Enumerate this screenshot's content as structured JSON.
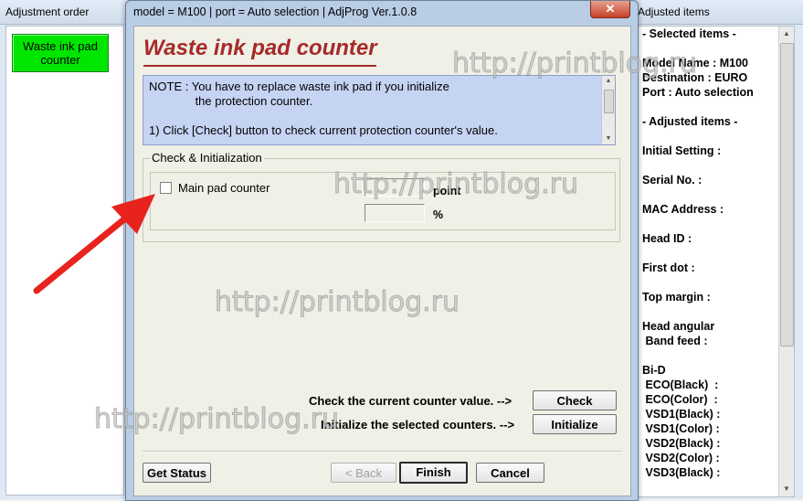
{
  "left_window": {
    "title": "Adjustment order",
    "button": "Waste ink pad\ncounter",
    "button_color": "#00e600"
  },
  "dialog": {
    "title": "model = M100 | port = Auto selection | AdjProg Ver.1.0.8",
    "close_glyph": "✕",
    "heading": "Waste ink pad counter",
    "note": "NOTE : You have to replace waste ink pad if you initialize\n              the protection counter.\n\n1) Click [Check] button to check current protection counter's value.",
    "group_label": "Check & Initialization",
    "checkbox_label": "Main pad counter",
    "unit_point": "point",
    "unit_percent": "%",
    "check_hint": "Check the current counter value.  -->",
    "check_btn": "Check",
    "init_hint": "Initialize the selected counters.  -->",
    "init_btn": "Initialize",
    "get_status_btn": "Get Status",
    "back_btn": "< Back",
    "finish_btn": "Finish",
    "cancel_btn": "Cancel"
  },
  "right_window": {
    "title": "Adjusted items",
    "lines": {
      "l1": "- Selected items -",
      "l2": "Model Name : M100",
      "l3": "Destination : EURO",
      "l4": "Port : Auto selection",
      "l5": "- Adjusted items -",
      "l6": "Initial Setting :",
      "l7": "Serial No. :",
      "l8": "MAC Address :",
      "l9": "Head ID :",
      "l10": "First dot :",
      "l11": "Top margin :",
      "l12": "Head angular",
      "l13": " Band feed :",
      "l14": "Bi-D",
      "l15": " ECO(Black)  :",
      "l16": " ECO(Color)  :",
      "l17": " VSD1(Black) :",
      "l18": " VSD1(Color) :",
      "l19": " VSD2(Black) :",
      "l20": " VSD2(Color) :",
      "l21": " VSD3(Black) :"
    }
  },
  "watermark": "http://printblog.ru",
  "annotation_color": "#e8231e"
}
